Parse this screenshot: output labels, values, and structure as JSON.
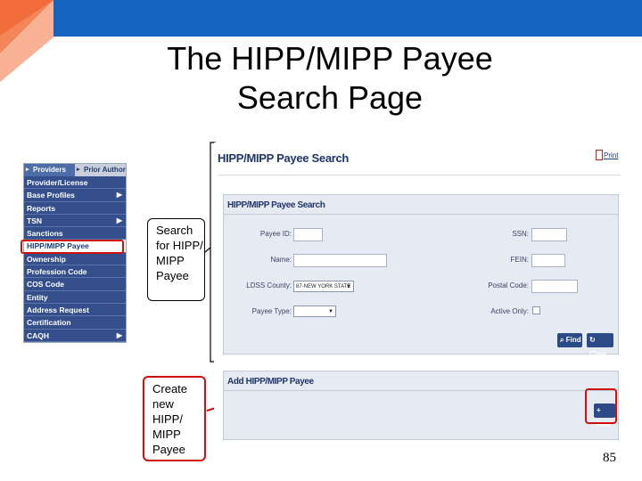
{
  "slide": {
    "title_line1": "The HIPP/MIPP Payee",
    "title_line2": "Search Page",
    "page_number": "85",
    "accent_colors": {
      "top_bar": "#1565c0",
      "corner_orange": "#f26b3a",
      "highlight_red": "#d01010"
    }
  },
  "menu": {
    "tabs": [
      {
        "label": "Providers",
        "icon": "chevron-right-icon"
      },
      {
        "label": "Prior Author",
        "icon": "chevron-right-icon"
      }
    ],
    "items": [
      {
        "label": "Provider/License",
        "has_submenu": false,
        "selected": false
      },
      {
        "label": "Base Profiles",
        "has_submenu": true,
        "selected": false
      },
      {
        "label": "Reports",
        "has_submenu": false,
        "selected": false
      },
      {
        "label": "TSN",
        "has_submenu": true,
        "selected": false
      },
      {
        "label": "Sanctions",
        "has_submenu": false,
        "selected": false
      },
      {
        "label": "HIPP/MIPP Payee",
        "has_submenu": false,
        "selected": true
      },
      {
        "label": "Ownership",
        "has_submenu": false,
        "selected": false
      },
      {
        "label": "Profession Code",
        "has_submenu": false,
        "selected": false
      },
      {
        "label": "COS Code",
        "has_submenu": false,
        "selected": false
      },
      {
        "label": "Entity",
        "has_submenu": false,
        "selected": false
      },
      {
        "label": "Address Request",
        "has_submenu": false,
        "selected": false
      },
      {
        "label": "Certification",
        "has_submenu": false,
        "selected": false
      },
      {
        "label": "CAQH",
        "has_submenu": true,
        "selected": false
      }
    ]
  },
  "callouts": {
    "search": "Search for HIPP/ MIPP Payee",
    "create": "Create new HIPP/ MIPP Payee"
  },
  "screen": {
    "title": "HIPP/MIPP Payee Search",
    "print_label": "Print",
    "search_panel": {
      "heading": "HIPP/MIPP Payee Search",
      "fields": {
        "payee_id_label": "Payee ID:",
        "name_label": "Name:",
        "ldss_county_label": "LDSS County:",
        "ldss_county_value": "87-NEW YORK STATE",
        "payee_type_label": "Payee Type:",
        "payee_type_value": "",
        "ssn_label": "SSN:",
        "fein_label": "FEIN:",
        "postal_code_label": "Postal Code:",
        "active_only_label": "Active Only:"
      },
      "find_button": "Find",
      "clear_button": "Clear"
    },
    "add_panel": {
      "heading": "Add HIPP/MIPP Payee",
      "add_button": "Add"
    }
  }
}
